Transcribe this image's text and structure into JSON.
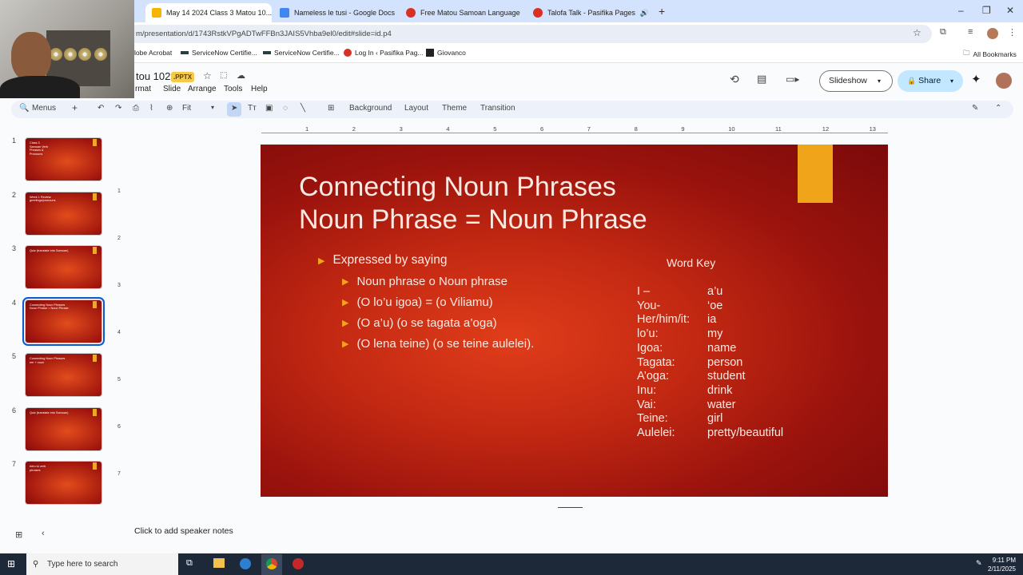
{
  "browser": {
    "tabs": [
      {
        "label": "May 14 2024 Class 3 Matou 10...",
        "favicon_color": "#f4b400",
        "active": true
      },
      {
        "label": "Nameless le tusi - Google Docs",
        "favicon_color": "#4285f4",
        "active": false
      },
      {
        "label": "Free Matou Samoan Language",
        "favicon_color": "#d93025",
        "active": false
      },
      {
        "label": "Talofa Talk - Pasifika Pages",
        "favicon_color": "#d93025",
        "active": false
      }
    ],
    "url": "m/presentation/d/1743RstkVPgADTwFFBn3JAIS5Vhba9el0/edit#slide=id.p4",
    "bookmarks": [
      "lobe Acrobat",
      "ServiceNow Certifie...",
      "ServiceNow Certifie...",
      "Log In ‹ Pasifika Pag...",
      "Giovanco"
    ],
    "all_bookmarks": "All Bookmarks"
  },
  "app": {
    "title": "tou 102",
    "badge": ".PPTX",
    "menus": [
      "rmat",
      "Slide",
      "Arrange",
      "Tools",
      "Help"
    ],
    "slideshow": "Slideshow",
    "share": "Share",
    "toolbar": {
      "menus": "Menus",
      "zoom": "Fit",
      "background": "Background",
      "layout": "Layout",
      "theme": "Theme",
      "transition": "Transition"
    }
  },
  "ruler": {
    "h_ticks": [
      "1",
      "2",
      "3",
      "4",
      "5",
      "6",
      "7",
      "8",
      "9",
      "10",
      "11",
      "12",
      "13"
    ],
    "v_ticks": [
      "1",
      "2",
      "3",
      "4",
      "5",
      "6",
      "7"
    ]
  },
  "filmstrip": [
    {
      "num": "1",
      "title": "Class 3\nSamoan Verb\nPhrases &\nPronouns"
    },
    {
      "num": "2",
      "title": "Week 1 Review:\ngreetings/pronouns"
    },
    {
      "num": "3",
      "title": "Quiz (translate into Samoan)"
    },
    {
      "num": "4",
      "title": "Connecting Noun Phrases\nNoun Phrase = Noun Phrase",
      "selected": true
    },
    {
      "num": "5",
      "title": "Connecting Noun Phrases\nme + noun"
    },
    {
      "num": "6",
      "title": "Quiz (translate into Samoan)"
    },
    {
      "num": "7",
      "title": "Intro to verb\nphrases"
    }
  ],
  "slide": {
    "title": "Connecting Noun Phrases\nNoun Phrase = Noun Phrase",
    "bullet_main": "Expressed by saying",
    "sub_bullets": [
      "Noun phrase o Noun phrase",
      "(O lo’u igoa) = (o Viliamu)",
      "(O a’u) (o se tagata a’oga)",
      "(O lena teine) (o se teine aulelei)."
    ],
    "word_key_title": "Word Key",
    "word_key": [
      {
        "s": "I –",
        "e": "a’u"
      },
      {
        "s": "You-",
        "e": "‘oe"
      },
      {
        "s": "Her/him/it:",
        "e": "ia"
      },
      {
        "s": "lo’u:",
        "e": "my"
      },
      {
        "s": "Igoa:",
        "e": "name"
      },
      {
        "s": "Tagata:",
        "e": "person"
      },
      {
        "s": "A’oga:",
        "e": "student"
      },
      {
        "s": "Inu:",
        "e": "drink"
      },
      {
        "s": "Vai:",
        "e": "water"
      },
      {
        "s": "Teine:",
        "e": "girl"
      },
      {
        "s": "Aulelei:",
        "e": "pretty/beautiful"
      }
    ]
  },
  "notes_placeholder": "Click to add speaker notes",
  "taskbar": {
    "search": "Type here to search",
    "time": "9:11 PM",
    "date": "2/11/2025"
  }
}
